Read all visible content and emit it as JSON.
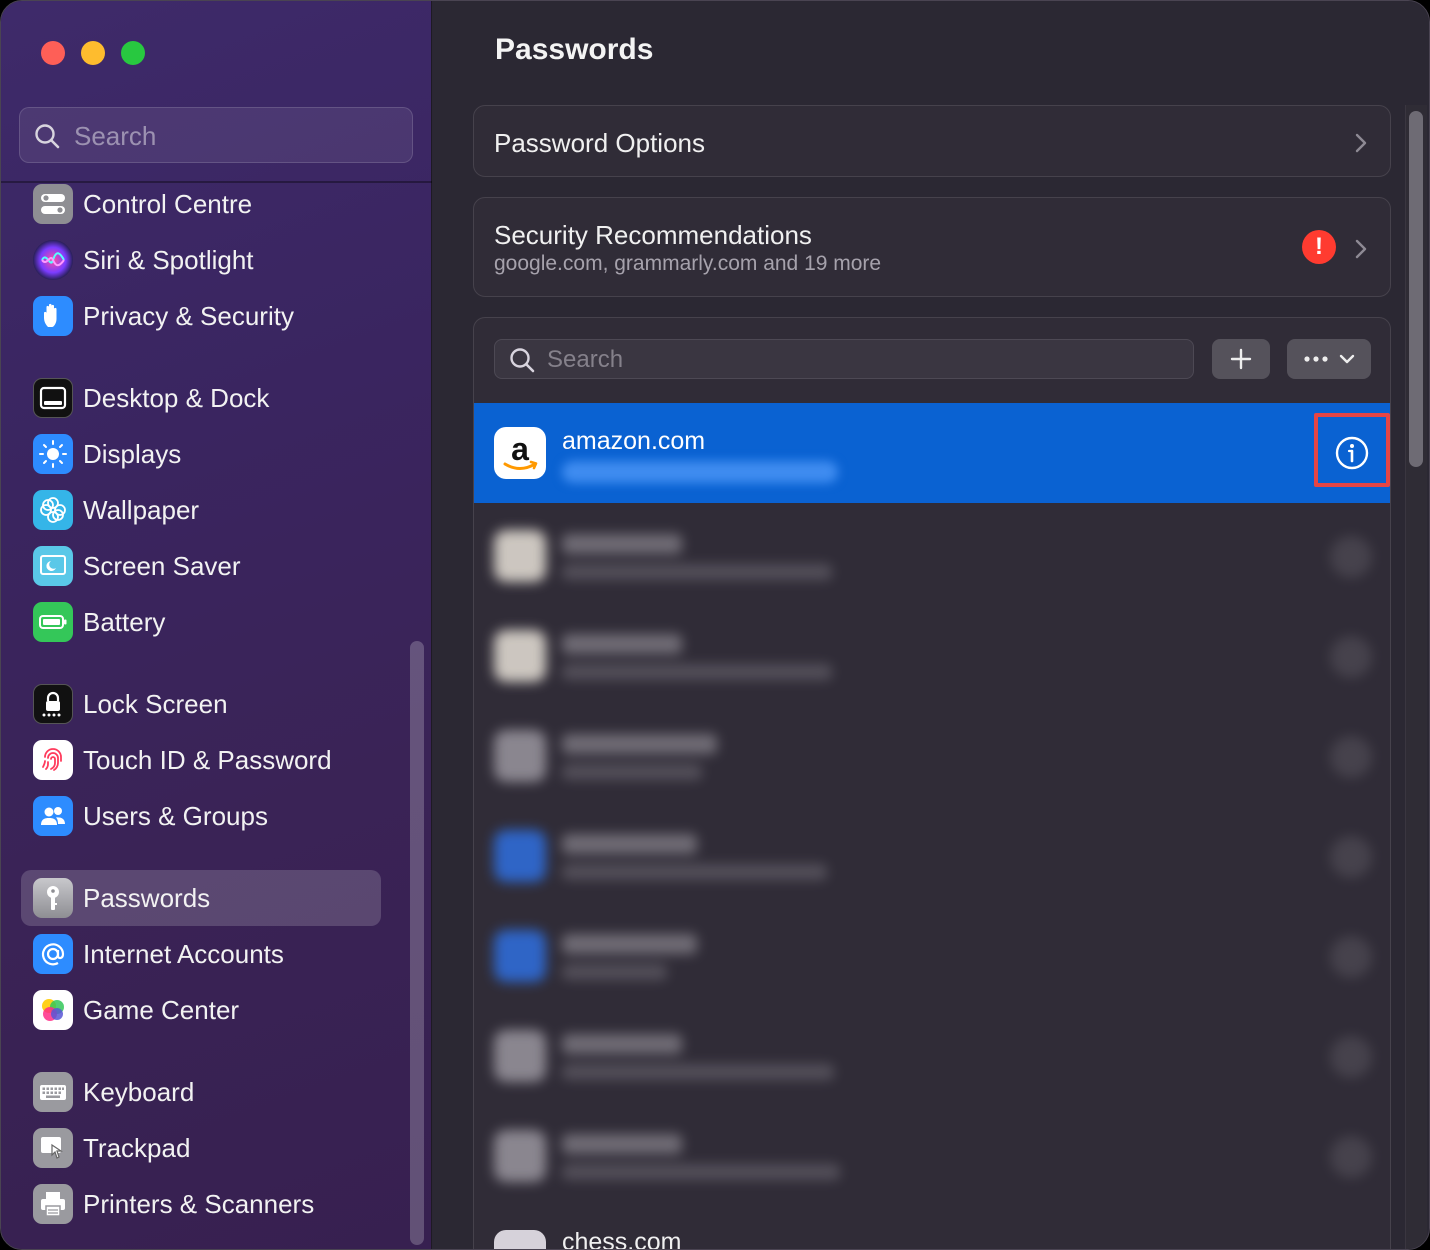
{
  "window": {
    "traffic_lights": [
      "close",
      "minimize",
      "zoom"
    ]
  },
  "sidebar": {
    "search_placeholder": "Search",
    "items": [
      {
        "label": "Control Centre",
        "icon": "control-centre-icon"
      },
      {
        "label": "Siri & Spotlight",
        "icon": "siri-icon"
      },
      {
        "label": "Privacy & Security",
        "icon": "hand-icon"
      },
      {
        "label": "Desktop & Dock",
        "icon": "dock-icon"
      },
      {
        "label": "Displays",
        "icon": "sun-icon"
      },
      {
        "label": "Wallpaper",
        "icon": "flower-icon"
      },
      {
        "label": "Screen Saver",
        "icon": "screensaver-icon"
      },
      {
        "label": "Battery",
        "icon": "battery-icon"
      },
      {
        "label": "Lock Screen",
        "icon": "lock-icon"
      },
      {
        "label": "Touch ID & Password",
        "icon": "fingerprint-icon"
      },
      {
        "label": "Users & Groups",
        "icon": "users-icon"
      },
      {
        "label": "Passwords",
        "icon": "key-icon",
        "selected": true
      },
      {
        "label": "Internet Accounts",
        "icon": "at-icon"
      },
      {
        "label": "Game Center",
        "icon": "game-center-icon"
      },
      {
        "label": "Keyboard",
        "icon": "keyboard-icon"
      },
      {
        "label": "Trackpad",
        "icon": "trackpad-icon"
      },
      {
        "label": "Printers & Scanners",
        "icon": "printer-icon"
      }
    ]
  },
  "main": {
    "title": "Passwords",
    "password_options": {
      "label": "Password Options"
    },
    "security": {
      "title": "Security Recommendations",
      "subtitle": "google.com, grammarly.com and 19 more",
      "alert_glyph": "!"
    },
    "list": {
      "search_placeholder": "Search",
      "selected_entry": {
        "site": "amazon.com"
      },
      "partial_entry": {
        "site": "chess.com"
      }
    }
  },
  "colors": {
    "accent_blue": "#0a62d2",
    "alert_red": "#ff3b30",
    "highlight_red": "#e64545"
  }
}
